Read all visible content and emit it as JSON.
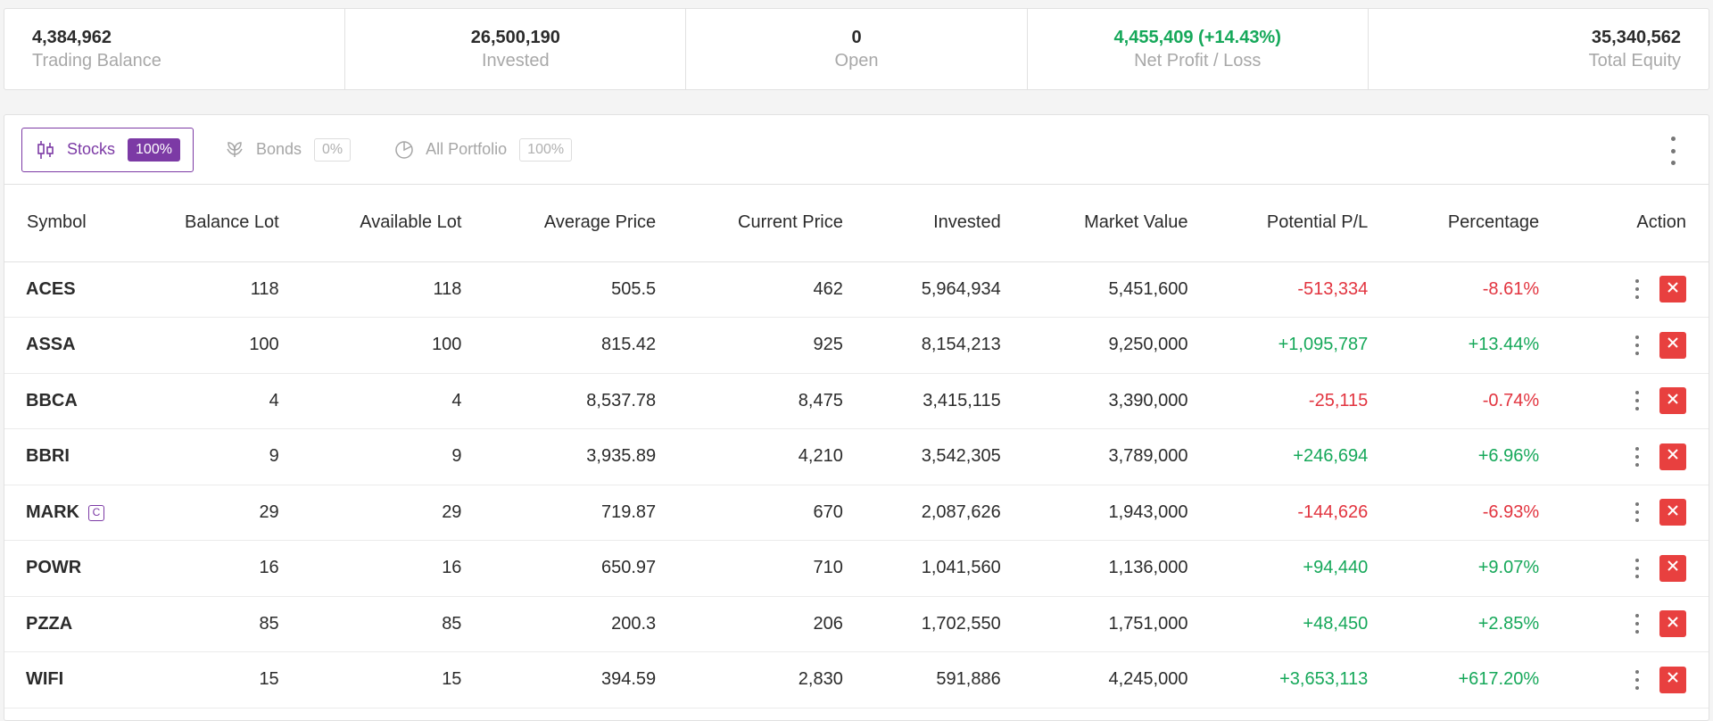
{
  "summary": [
    {
      "value": "4,384,962",
      "label": "Trading Balance",
      "align": "left",
      "color": ""
    },
    {
      "value": "26,500,190",
      "label": "Invested",
      "align": "center",
      "color": ""
    },
    {
      "value": "0",
      "label": "Open",
      "align": "center",
      "color": ""
    },
    {
      "value": "4,455,409 (+14.43%)",
      "label": "Net Profit / Loss",
      "align": "center",
      "color": "green"
    },
    {
      "value": "35,340,562",
      "label": "Total Equity",
      "align": "right",
      "color": ""
    }
  ],
  "tabs": [
    {
      "icon": "candlestick-icon",
      "label": "Stocks",
      "badge": "100%",
      "active": true
    },
    {
      "icon": "bonds-icon",
      "label": "Bonds",
      "badge": "0%",
      "active": false
    },
    {
      "icon": "pie-chart-icon",
      "label": "All Portfolio",
      "badge": "100%",
      "active": false
    }
  ],
  "columns": [
    "Symbol",
    "Balance Lot",
    "Available Lot",
    "Average Price",
    "Current Price",
    "Invested",
    "Market Value",
    "Potential P/L",
    "Percentage",
    "Action"
  ],
  "rows": [
    {
      "symbol": "ACES",
      "tag": "",
      "balance": "118",
      "available": "118",
      "avg": "505.5",
      "current": "462",
      "invested": "5,964,934",
      "market": "5,451,600",
      "pl": "-513,334",
      "pct": "-8.61%",
      "trend": "neg"
    },
    {
      "symbol": "ASSA",
      "tag": "",
      "balance": "100",
      "available": "100",
      "avg": "815.42",
      "current": "925",
      "invested": "8,154,213",
      "market": "9,250,000",
      "pl": "+1,095,787",
      "pct": "+13.44%",
      "trend": "pos"
    },
    {
      "symbol": "BBCA",
      "tag": "",
      "balance": "4",
      "available": "4",
      "avg": "8,537.78",
      "current": "8,475",
      "invested": "3,415,115",
      "market": "3,390,000",
      "pl": "-25,115",
      "pct": "-0.74%",
      "trend": "neg"
    },
    {
      "symbol": "BBRI",
      "tag": "",
      "balance": "9",
      "available": "9",
      "avg": "3,935.89",
      "current": "4,210",
      "invested": "3,542,305",
      "market": "3,789,000",
      "pl": "+246,694",
      "pct": "+6.96%",
      "trend": "pos"
    },
    {
      "symbol": "MARK",
      "tag": "C",
      "balance": "29",
      "available": "29",
      "avg": "719.87",
      "current": "670",
      "invested": "2,087,626",
      "market": "1,943,000",
      "pl": "-144,626",
      "pct": "-6.93%",
      "trend": "neg"
    },
    {
      "symbol": "POWR",
      "tag": "",
      "balance": "16",
      "available": "16",
      "avg": "650.97",
      "current": "710",
      "invested": "1,041,560",
      "market": "1,136,000",
      "pl": "+94,440",
      "pct": "+9.07%",
      "trend": "pos"
    },
    {
      "symbol": "PZZA",
      "tag": "",
      "balance": "85",
      "available": "85",
      "avg": "200.3",
      "current": "206",
      "invested": "1,702,550",
      "market": "1,751,000",
      "pl": "+48,450",
      "pct": "+2.85%",
      "trend": "pos"
    },
    {
      "symbol": "WIFI",
      "tag": "",
      "balance": "15",
      "available": "15",
      "avg": "394.59",
      "current": "2,830",
      "invested": "591,886",
      "market": "4,245,000",
      "pl": "+3,653,113",
      "pct": "+617.20%",
      "trend": "pos"
    }
  ],
  "colors": {
    "accent": "#7c3aa5",
    "positive": "#16a85a",
    "negative": "#e2343f",
    "delete": "#e8403f"
  }
}
